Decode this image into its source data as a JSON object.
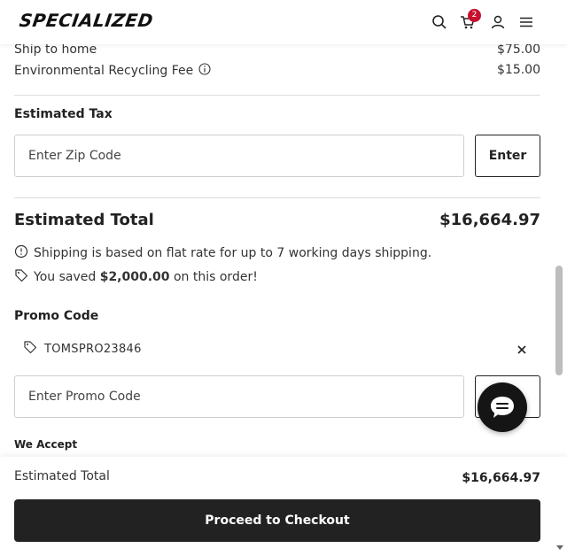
{
  "header": {
    "logo": "SPECIALIZED",
    "cart_count": "2",
    "icons": [
      "search-icon",
      "cart-icon",
      "account-icon",
      "menu-icon"
    ]
  },
  "summary": {
    "ship_label": "Ship to home",
    "ship_value": "$75.00",
    "recycling_label": "Environmental Recycling Fee",
    "recycling_value": "$15.00"
  },
  "tax": {
    "label": "Estimated Tax",
    "zip_placeholder": "Enter Zip Code",
    "enter_button": "Enter"
  },
  "total": {
    "label": "Estimated Total",
    "value": "$16,664.97",
    "shipping_note": "Shipping is based on flat rate for up to 7 working days shipping.",
    "saved_prefix": "You saved ",
    "saved_amount": "$2,000.00",
    "saved_suffix": " on this order!"
  },
  "promo": {
    "label": "Promo Code",
    "applied_code": "TOMSPRO23846",
    "input_placeholder": "Enter Promo Code"
  },
  "payment": {
    "we_accept_label": "We Accept"
  },
  "footer": {
    "total_label": "Estimated Total",
    "total_value": "$16,664.97",
    "checkout_label": "Proceed to Checkout"
  },
  "colors": {
    "badge": "#c8102e",
    "button_dark": "#222222",
    "chat_fab": "#151515"
  }
}
